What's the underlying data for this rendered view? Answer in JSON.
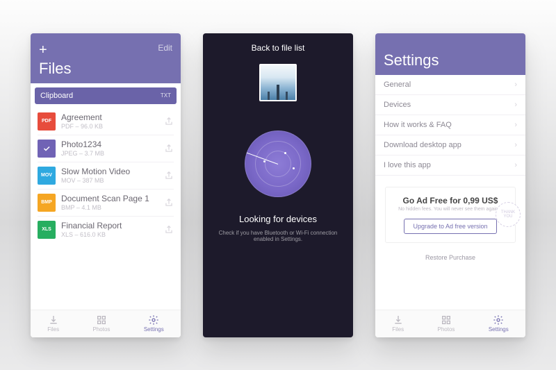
{
  "screen1": {
    "edit": "Edit",
    "title": "Files",
    "clipboard": {
      "label": "Clipboard",
      "badge": "TXT"
    },
    "files": [
      {
        "icon": "pdf",
        "iconText": "PDF",
        "name": "Agreement",
        "meta": "PDF – 96.0 KB"
      },
      {
        "icon": "check",
        "iconText": "",
        "name": "Photo1234",
        "meta": "JPEG – 3.7 MB"
      },
      {
        "icon": "mov",
        "iconText": "MOV",
        "name": "Slow Motion Video",
        "meta": "MOV – 387 MB"
      },
      {
        "icon": "bmp",
        "iconText": "BMP",
        "name": "Document Scan Page 1",
        "meta": "BMP – 4.1 MB"
      },
      {
        "icon": "xls",
        "iconText": "XLS",
        "name": "Financial Report",
        "meta": "XLS – 616.0 KB"
      }
    ],
    "tabs": {
      "files": "Files",
      "photos": "Photos",
      "settings": "Settings",
      "active": "settings"
    }
  },
  "screen2": {
    "back": "Back to file list",
    "looking": "Looking for devices",
    "hint": "Check if you have Bluetooth or Wi-Fi connection enabled in Settings."
  },
  "screen3": {
    "title": "Settings",
    "rows": [
      "General",
      "Devices",
      "How it works & FAQ",
      "Download desktop app",
      "I love this app"
    ],
    "promo": {
      "title": "Go Ad Free for 0,99 US$",
      "sub": "No hidden fees. You will never see them again :)",
      "cta": "Upgrade to Ad free version",
      "stamp": "THANK YOU"
    },
    "restore": "Restore Purchase",
    "tabs": {
      "files": "Files",
      "photos": "Photos",
      "settings": "Settings",
      "active": "settings"
    }
  }
}
